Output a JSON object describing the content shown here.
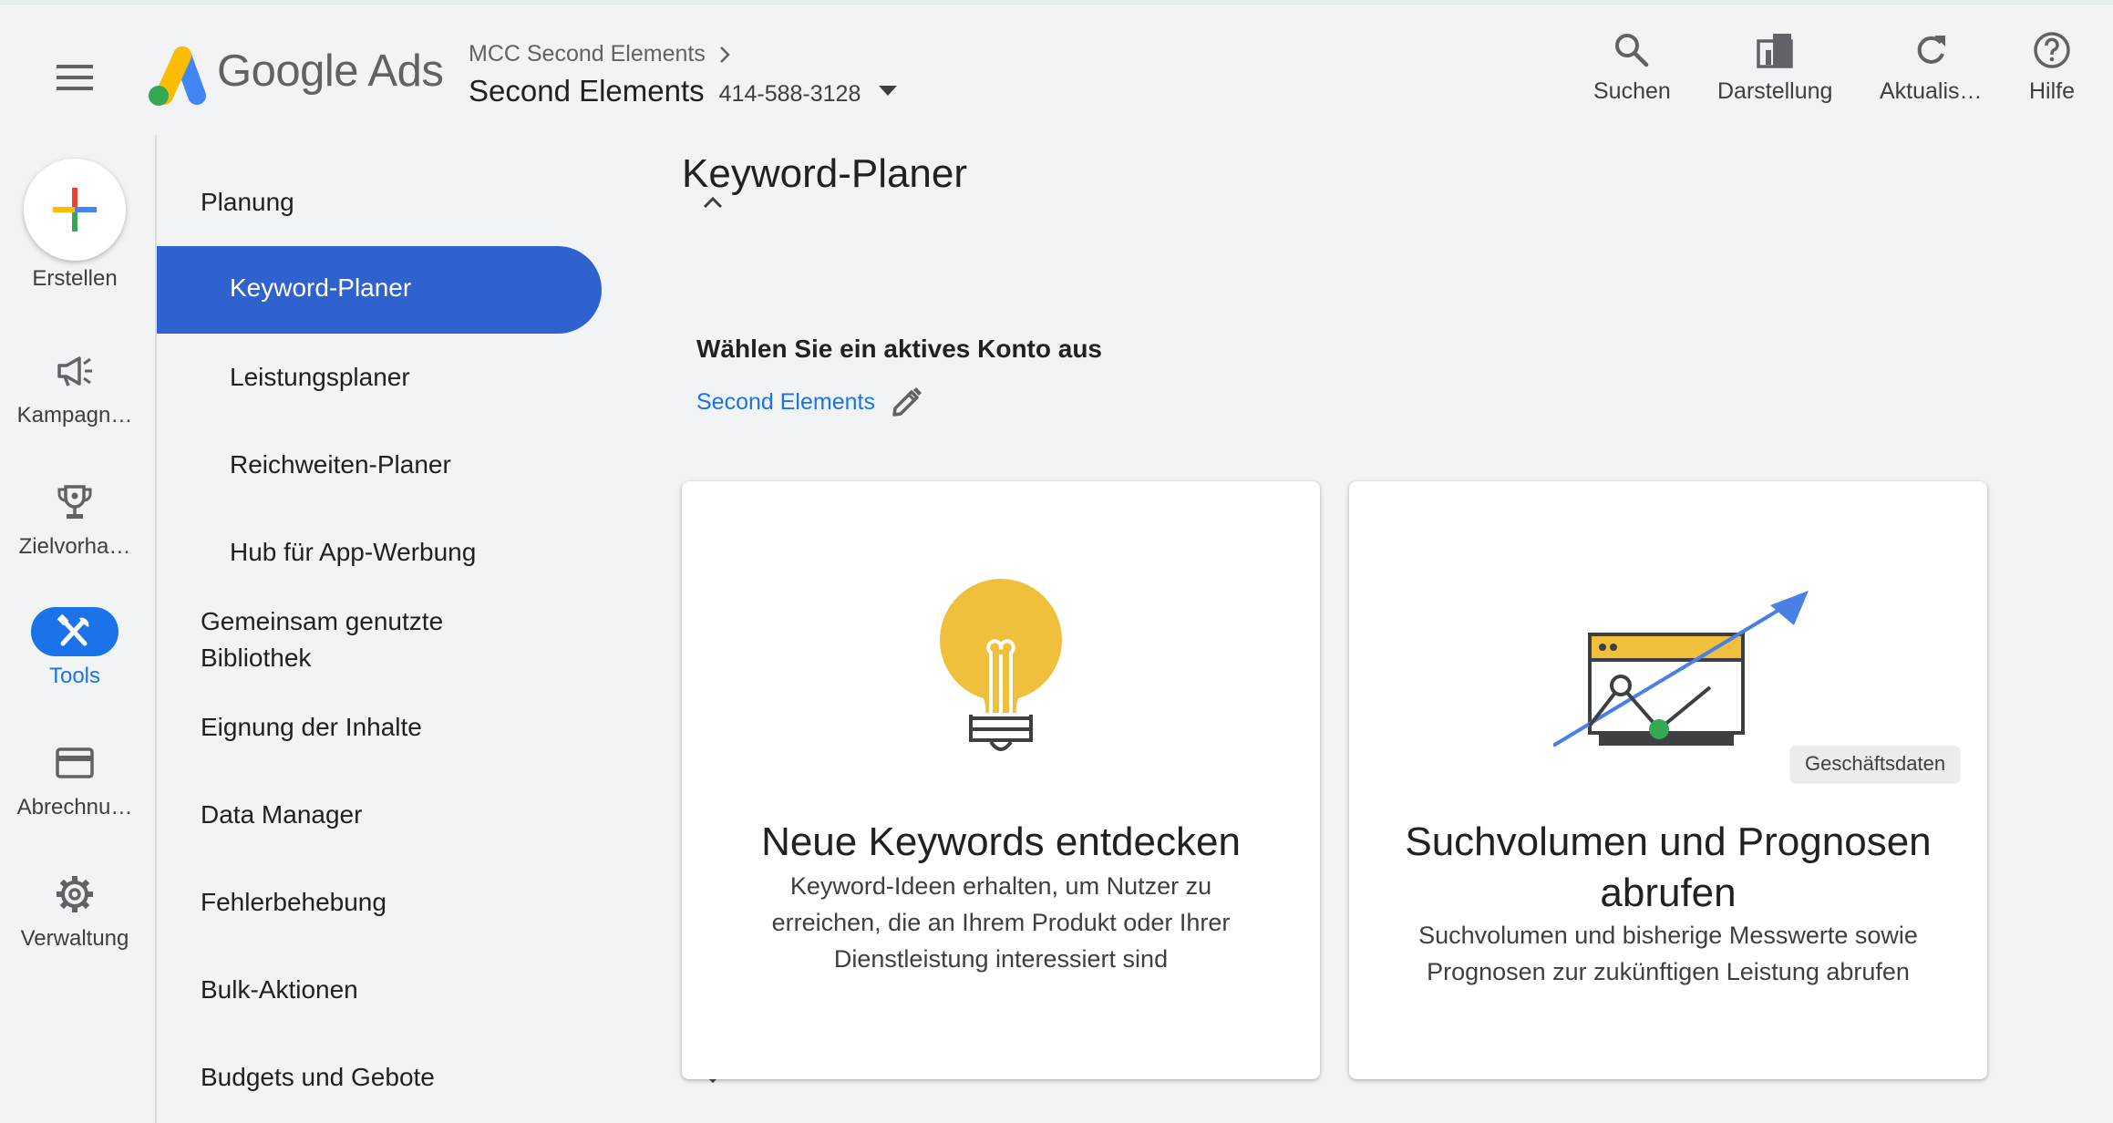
{
  "header": {
    "brand_name": "Google Ads",
    "mcc_label": "MCC Second Elements",
    "account_name": "Second Elements",
    "customer_id": "414-588-3128",
    "actions": {
      "search": "Suchen",
      "appearance": "Darstellung",
      "refresh": "Aktualis…",
      "help": "Hilfe"
    }
  },
  "rail": {
    "create": "Erstellen",
    "campaigns": "Kampagn…",
    "goals": "Zielvorha…",
    "tools": "Tools",
    "billing": "Abrechnu…",
    "admin": "Verwaltung"
  },
  "nav": {
    "planning": "Planung",
    "keyword_planner": "Keyword-Planer",
    "performance_planner": "Leistungsplaner",
    "reach_planner": "Reichweiten-Planer",
    "app_hub": "Hub für App-Werbung",
    "shared_library_line1": "Gemeinsam genutzte",
    "shared_library_line2": "Bibliothek",
    "content_suitability": "Eignung der Inhalte",
    "data_manager": "Data Manager",
    "troubleshooting": "Fehlerbehebung",
    "bulk_actions": "Bulk-Aktionen",
    "budgets_bids": "Budgets und Gebote"
  },
  "main": {
    "page_title": "Keyword-Planer",
    "choose_account_label": "Wählen Sie ein aktives Konto aus",
    "selected_account": "Second Elements",
    "cards": [
      {
        "title": "Neue Keywords entdecken",
        "description": "Keyword-Ideen erhalten, um Nutzer zu erreichen, die an Ihrem Produkt oder Ihrer Dienstleistung interessiert sind"
      },
      {
        "title": "Suchvolumen und Prognosen abrufen",
        "description": "Suchvolumen und bisherige Messwerte sowie Prognosen zur zukünftigen Leistung abrufen",
        "tooltip": "Geschäftsdaten"
      }
    ]
  },
  "colors": {
    "accent_blue": "#1a73e8",
    "active_nav": "#2f62cf",
    "bulb_yellow": "#f0c03d",
    "chart_green": "#34a853"
  }
}
